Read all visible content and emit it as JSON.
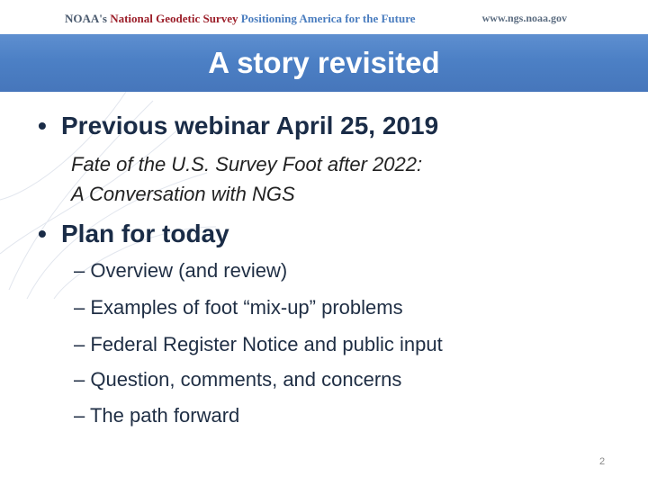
{
  "header": {
    "brand_noaa": "NOAA's",
    "brand_ngs": "National Geodetic Survey",
    "brand_tagline": "Positioning America for the Future",
    "url": "www.ngs.noaa.gov"
  },
  "slide": {
    "title": "A story revisited",
    "bullets": [
      {
        "text": "Previous webinar April 25, 2019",
        "sub_lines": [
          "Fate of the U.S. Survey Foot after 2022:",
          "A Conversation with NGS"
        ]
      },
      {
        "text": "Plan for today",
        "sub_items": [
          "– Overview (and review)",
          "– Examples of foot “mix-up” problems",
          "– Federal Register Notice and public input",
          "– Question, comments, and concerns",
          "– The path forward"
        ]
      }
    ],
    "page_number": "2"
  },
  "colors": {
    "title_bar": "#4c80c5",
    "bullet_text": "#1a2c47",
    "brand_red": "#9c1f2a",
    "tagline_blue": "#4a7dbf"
  }
}
